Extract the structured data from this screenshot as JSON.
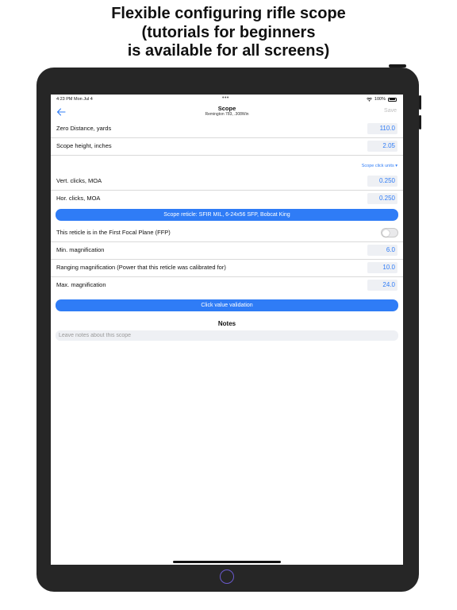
{
  "promo": {
    "line1": "Flexible configuring rifle scope",
    "line2": "(tutorials for beginners",
    "line3": "is available for all screens)"
  },
  "status_bar": {
    "time": "4:23 PM   Mon Jul 4",
    "dots": "•••",
    "battery": "100%"
  },
  "nav": {
    "title": "Scope",
    "subtitle": "Remington 783, .308Win",
    "save_label": "Save"
  },
  "fields": {
    "zero_distance": {
      "label": "Zero Distance, yards",
      "value": "110.0"
    },
    "scope_height": {
      "label": "Scope height, inches",
      "value": "2.05"
    },
    "click_units_link": "Scope click units ▾",
    "vert_clicks": {
      "label": "Vert. clicks, MOA",
      "value": "0.250"
    },
    "hor_clicks": {
      "label": "Hor. clicks, MOA",
      "value": "0.250"
    },
    "reticle_button": {
      "prefix": "Scope reticle: ",
      "name": "SFIR MIL, 6-24x56 SFP, Bobcat King"
    },
    "ffp": {
      "label": "This reticle is in the First Focal Plane (FFP)",
      "on": false
    },
    "min_mag": {
      "label": "Min. magnification",
      "value": "6.0"
    },
    "ranging_mag": {
      "label": "Ranging magnification (Power that this reticle was calibrated for)",
      "value": "10.0"
    },
    "max_mag": {
      "label": "Max. magnification",
      "value": "24.0"
    },
    "validation_button": "Click value validation"
  },
  "notes": {
    "title": "Notes",
    "placeholder": "Leave notes about this scope"
  },
  "colors": {
    "accent": "#2f7cf6",
    "device": "#262626"
  }
}
